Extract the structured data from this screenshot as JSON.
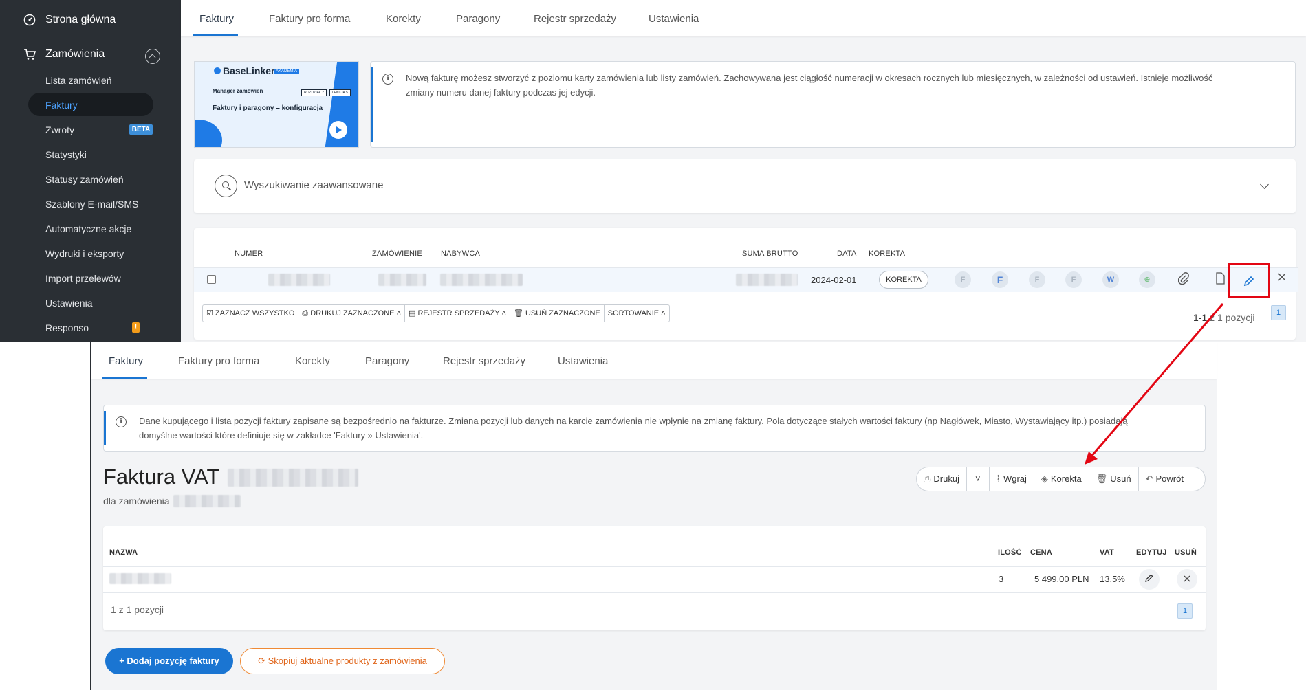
{
  "sidebar": {
    "home": "Strona główna",
    "orders": "Zamówienia",
    "items": [
      {
        "label": "Lista zamówień"
      },
      {
        "label": "Faktury"
      },
      {
        "label": "Zwroty",
        "badge": "BETA"
      },
      {
        "label": "Statystyki"
      },
      {
        "label": "Statusy zamówień"
      },
      {
        "label": "Szablony E-mail/SMS"
      },
      {
        "label": "Automatyczne akcje"
      },
      {
        "label": "Wydruki i eksporty"
      },
      {
        "label": "Import przelewów"
      },
      {
        "label": "Ustawienia"
      },
      {
        "label": "Responso",
        "badge": "!"
      }
    ]
  },
  "tabs": [
    "Faktury",
    "Faktury pro forma",
    "Korekty",
    "Paragony",
    "Rejestr sprzedaży",
    "Ustawienia"
  ],
  "promo": {
    "logo": "BaseLinker",
    "badge": "AKADEMIA",
    "subtitle": "Manager zamówień",
    "box1": "ROZDZIAŁ 2",
    "box2": "LEKCJA 5",
    "title": "Faktury i paragony – konfiguracja"
  },
  "top_info": {
    "line1": "Nową fakturę możesz stworzyć z poziomu karty zamówienia lub listy zamówień. Zachowywana jest ciągłość numeracji w okresach rocznych lub miesięcznych, w zależności od ustawień. Istnieje możliwość",
    "line2": "zmiany numeru danej faktury podczas jej edycji."
  },
  "advanced_search": "Wyszukiwanie zaawansowane",
  "invoice_table": {
    "headers": {
      "number": "NUMER",
      "order": "ZAMÓWIENIE",
      "buyer": "NABYWCA",
      "gross": "SUMA BRUTTO",
      "date": "DATA",
      "correction": "KOREKTA"
    },
    "row": {
      "date": "2024-02-01",
      "correction_button": "KOREKTA"
    },
    "row_icons": [
      "F",
      "F",
      "F",
      "F",
      "W",
      "⊕"
    ]
  },
  "toolbar": {
    "select_all": "ZAZNACZ WSZYSTKO",
    "print_selected": "DRUKUJ ZAZNACZONE",
    "sales_register": "REJESTR SPRZEDAŻY",
    "delete_selected": "USUŃ ZAZNACZONE",
    "sorting": "SORTOWANIE"
  },
  "pager_top": {
    "range": "1-1",
    "text": "z 1 pozycji",
    "page": "1"
  },
  "bottom_info": {
    "line1": "Dane kupującego i lista pozycji faktury zapisane są bezpośrednio na fakturze. Zmiana pozycji lub danych na karcie zamówienia nie wpłynie na zmianę faktury. Pola dotyczące stałych wartości faktury (np Nagłówek, Miasto, Wystawiający itp.) posiadają",
    "line2": "domyślne wartości które definiuje się w zakładce 'Faktury » Ustawienia'."
  },
  "invoice": {
    "title": "Faktura VAT",
    "subtitle": "dla zamówienia"
  },
  "actions": {
    "print": "Drukuj",
    "upload": "Wgraj",
    "correction": "Korekta",
    "delete": "Usuń",
    "back": "Powrót"
  },
  "items_table": {
    "headers": {
      "name": "NAZWA",
      "qty": "ILOŚĆ",
      "price": "CENA",
      "vat": "VAT",
      "edit": "EDYTUJ",
      "delete": "USUŃ"
    },
    "row": {
      "qty": "3",
      "price": "5 499,00 PLN",
      "vat": "13,5%"
    },
    "pager_text": "1 z 1 pozycji",
    "page": "1"
  },
  "buttons": {
    "add_position": "Dodaj pozycję faktury",
    "copy_products": "Skopiuj aktualne produkty z zamówienia"
  },
  "colors": {
    "accent": "#1a75d2",
    "highlight": "#e30613",
    "sidebar": "#2a2f34",
    "orange": "#ef8a35"
  }
}
